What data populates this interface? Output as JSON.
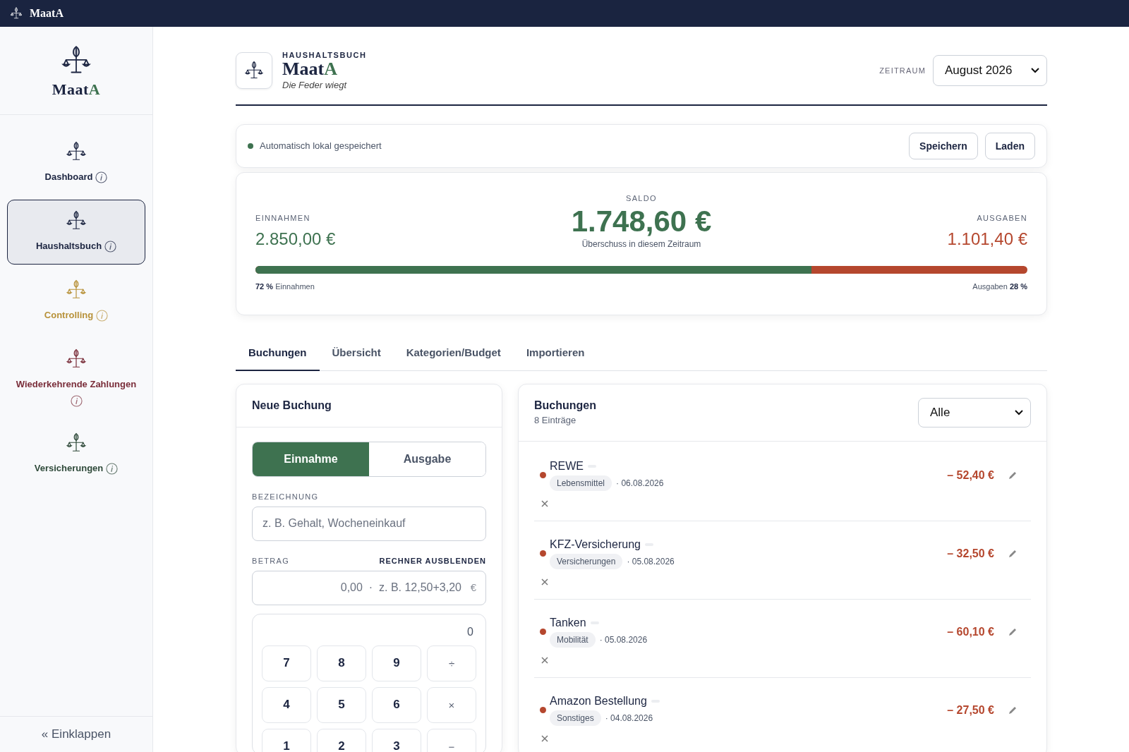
{
  "topbar": {
    "title": "MaatA"
  },
  "sidebar": {
    "brand": {
      "name": "Maat",
      "accent": "A"
    },
    "items": [
      {
        "label": "Dashboard",
        "color": "#1c2541",
        "selected": false
      },
      {
        "label": "Haushaltsbuch",
        "color": "#1c2541",
        "selected": true
      },
      {
        "label": "Controlling",
        "color": "#b8923a",
        "selected": false
      },
      {
        "label": "Wiederkehrende Zahlungen",
        "color": "#7a2e3a",
        "selected": false
      },
      {
        "label": "Versicherungen",
        "color": "#2f4a3a",
        "selected": false
      }
    ],
    "collapse": "« Einklappen"
  },
  "header": {
    "eyebrow": "HAUSHALTSBUCH",
    "brand": {
      "name": "Maat",
      "accent": "A"
    },
    "tagline": "Die Feder wiegt",
    "period_label": "ZEITRAUM",
    "period": "August 2026"
  },
  "save_bar": {
    "status": "Automatisch lokal gespeichert",
    "buttons": [
      "Speichern",
      "Laden"
    ]
  },
  "summary": {
    "income_label": "EINNAHMEN",
    "income": "2.850,00 €",
    "balance_label": "SALDO",
    "balance": "1.748,60 €",
    "balance_note": "Überschuss in diesem Zeitraum",
    "expense_label": "AUSGABEN",
    "expense": "1.101,40 €",
    "level": 0.72,
    "income_share": "**72 %** Einnahmen",
    "expense_share": "Ausgaben **28 %**"
  },
  "tabs": [
    {
      "label": "Buchungen",
      "selected": true
    },
    {
      "label": "Übersicht",
      "selected": false
    },
    {
      "label": "Kategorien/Budget",
      "selected": false
    },
    {
      "label": "Importieren",
      "selected": false
    }
  ],
  "new_booking": {
    "title": "Neue Buchung",
    "types": [
      {
        "label": "Einnahme",
        "selected": true
      },
      {
        "label": "Ausgabe",
        "selected": false
      }
    ],
    "name_label": "BEZEICHNUNG",
    "name_placeholder": "z. B. Gehalt, Wocheneinkauf",
    "amount_label": "BETRAG",
    "calc_toggle": "RECHNER AUSBLENDEN",
    "amount_placeholder": "0,00  ·  z. B. 12,50+3,20",
    "amount_suffix": "€",
    "calc_display": "0",
    "keys": [
      {
        "label": "7",
        "kind": "digit"
      },
      {
        "label": "8",
        "kind": "digit"
      },
      {
        "label": "9",
        "kind": "digit"
      },
      {
        "label": "÷",
        "kind": "operator"
      },
      {
        "label": "4",
        "kind": "digit"
      },
      {
        "label": "5",
        "kind": "digit"
      },
      {
        "label": "6",
        "kind": "digit"
      },
      {
        "label": "×",
        "kind": "operator"
      },
      {
        "label": "1",
        "kind": "digit"
      },
      {
        "label": "2",
        "kind": "digit"
      },
      {
        "label": "3",
        "kind": "digit"
      },
      {
        "label": "−",
        "kind": "operator"
      }
    ]
  },
  "bookings": {
    "title": "Buchungen",
    "count": "8 Einträge",
    "filter": "Alle",
    "rows": [
      {
        "name": "REWE",
        "category": "Lebensmittel",
        "date": "· 06.08.2026",
        "amount": "– 52,40 €",
        "color": "#b5472e"
      },
      {
        "name": "KFZ-Versicherung",
        "category": "Versicherungen",
        "date": "· 05.08.2026",
        "amount": "– 32,50 €",
        "color": "#b5472e"
      },
      {
        "name": "Tanken",
        "category": "Mobilität",
        "date": "· 05.08.2026",
        "amount": "– 60,10 €",
        "color": "#b5472e"
      },
      {
        "name": "Amazon Bestellung",
        "category": "Sonstiges",
        "date": "· 04.08.2026",
        "amount": "– 27,50 €",
        "color": "#b5472e"
      }
    ]
  }
}
